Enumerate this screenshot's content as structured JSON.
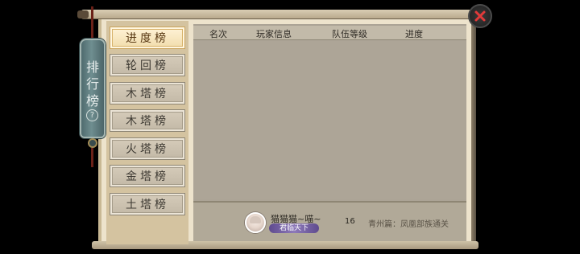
{
  "plaque": {
    "chars": [
      "排",
      "行",
      "榜"
    ],
    "help_label": "?"
  },
  "tabs": [
    {
      "label": "进度榜",
      "active": true
    },
    {
      "label": "轮回榜",
      "active": false
    },
    {
      "label": "木塔榜",
      "active": false
    },
    {
      "label": "木塔榜",
      "active": false
    },
    {
      "label": "火塔榜",
      "active": false
    },
    {
      "label": "金塔榜",
      "active": false
    },
    {
      "label": "土塔榜",
      "active": false
    }
  ],
  "table": {
    "headers": {
      "rank": "名次",
      "player_info": "玩家信息",
      "team_level": "队伍等级",
      "progress": "进度"
    }
  },
  "self": {
    "name": "猫猫猫~喵~",
    "title_badge": "君临天下",
    "level": "16",
    "progress": "青州篇：凤凰部族通关"
  },
  "colors": {
    "active_tab": "#f1dcaa",
    "close_x": "#e23a3a"
  }
}
